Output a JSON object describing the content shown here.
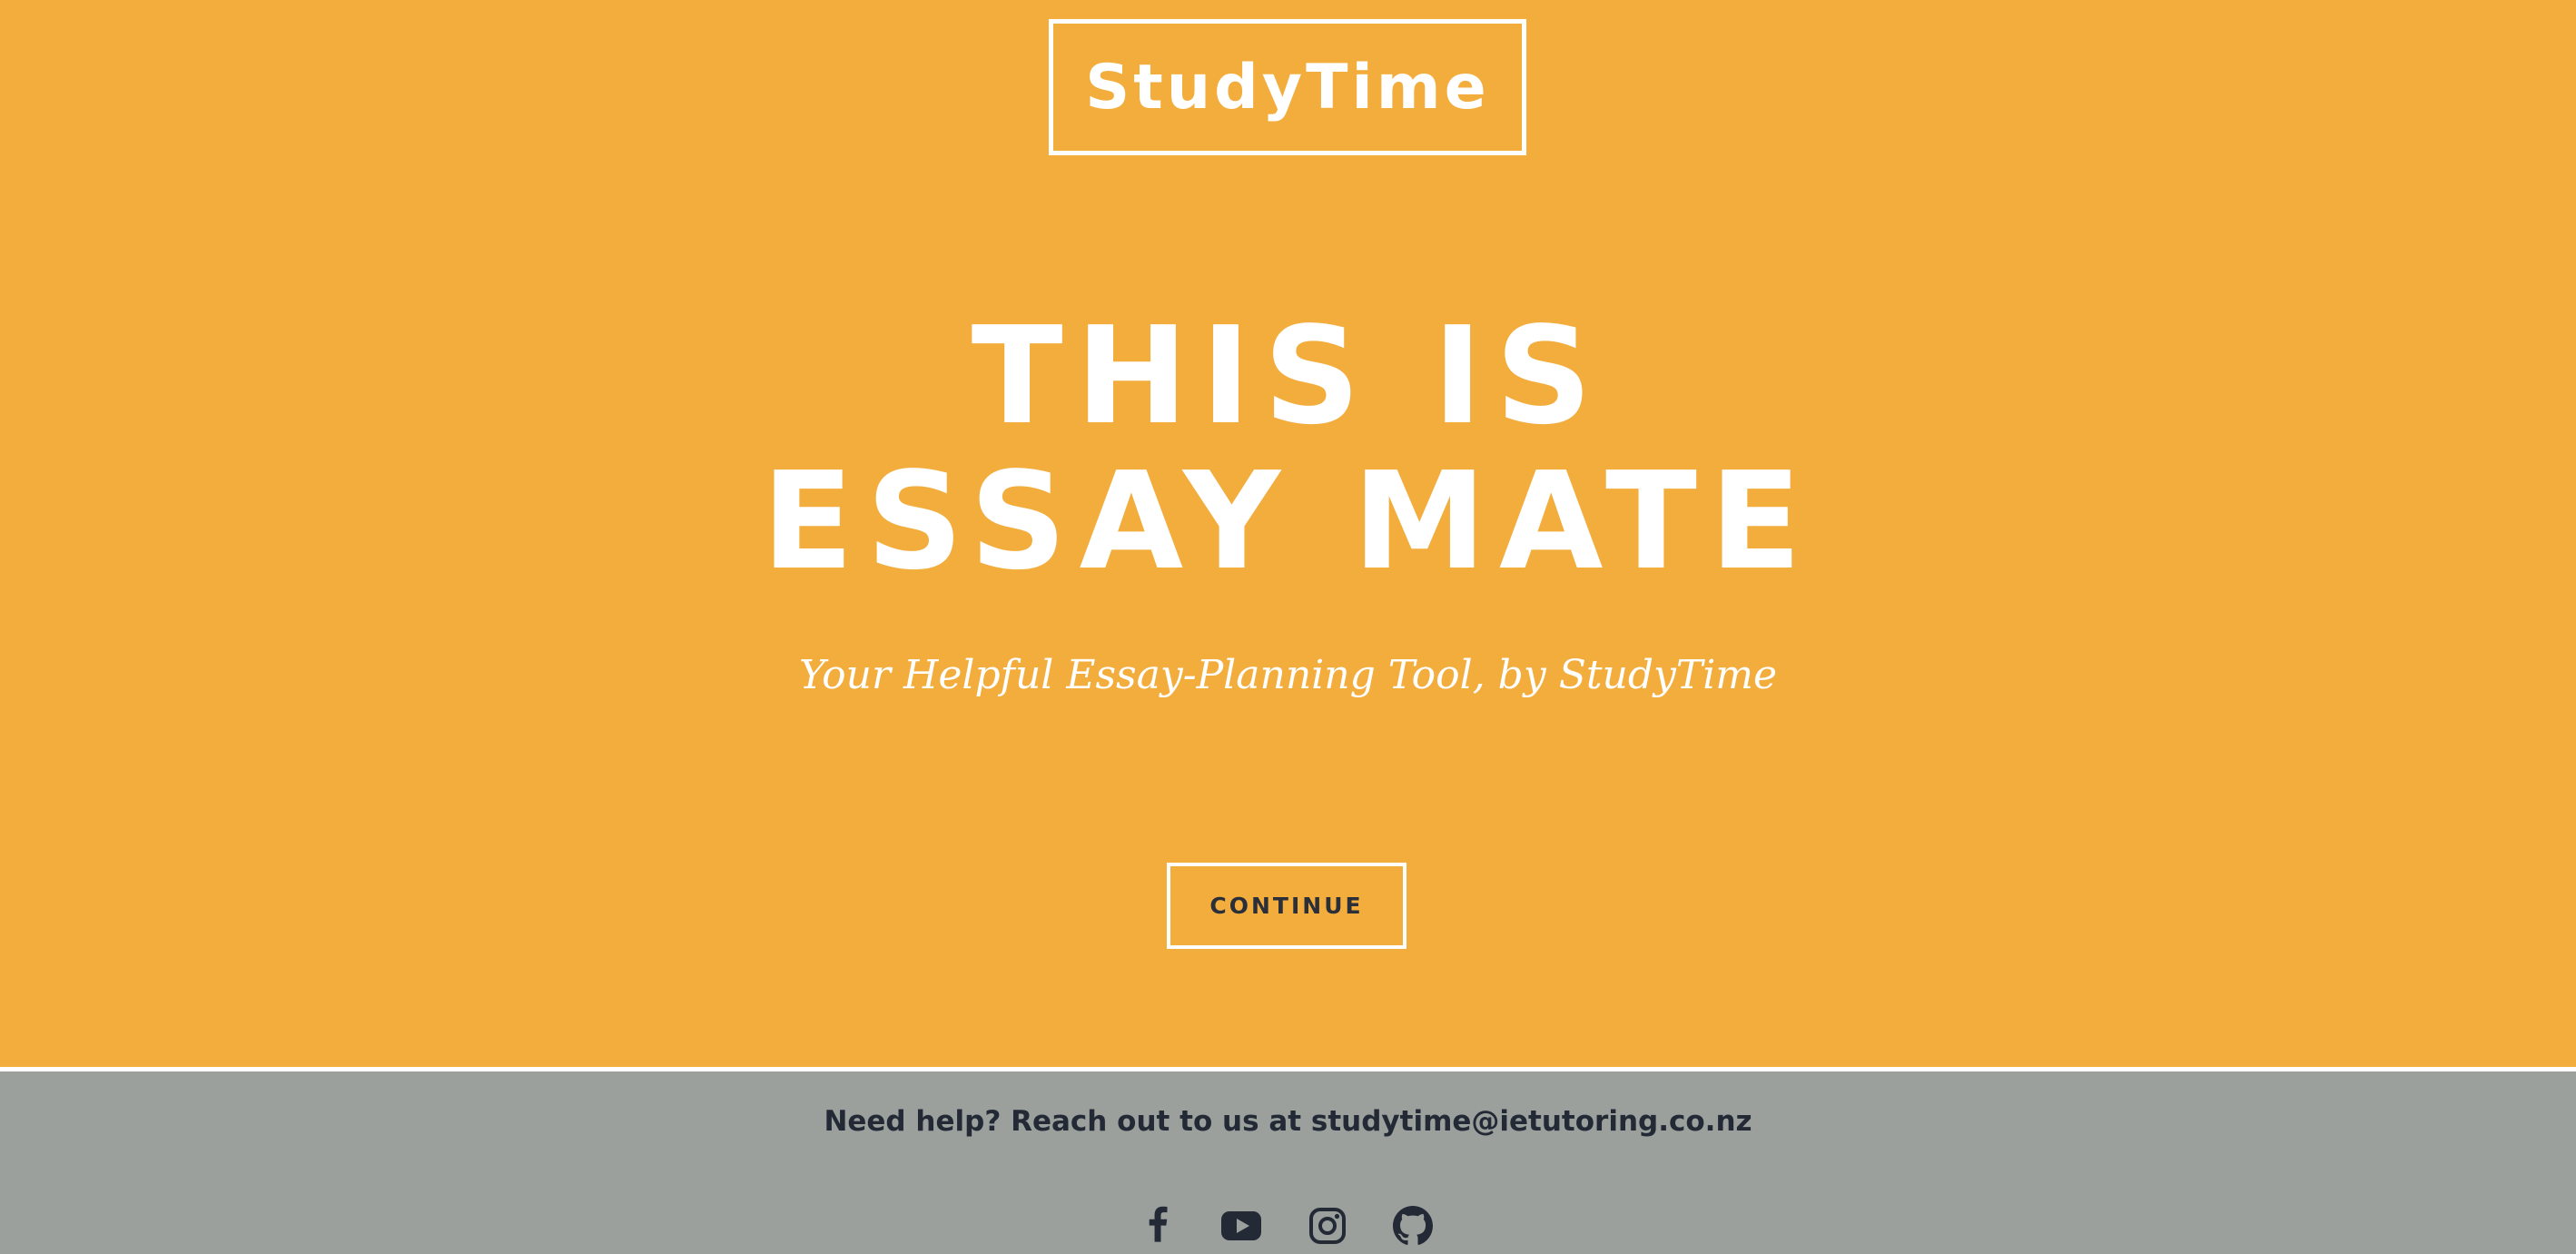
{
  "brand": {
    "logo_text": "StudyTime"
  },
  "hero": {
    "headline_line1": "THIS IS",
    "headline_line2": "ESSAY MATE",
    "tagline": "Your Helpful Essay-Planning Tool, by StudyTime",
    "continue_label": "CONTINUE"
  },
  "footer": {
    "help_text": "Need help? Reach out to us at studytime@ietutoring.co.nz",
    "social_icons": [
      "facebook-icon",
      "youtube-icon",
      "instagram-icon",
      "github-icon"
    ]
  },
  "colors": {
    "hero_background": "#f2ad3d",
    "footer_background": "#9ba09d",
    "text_light": "#ffffff",
    "text_dark": "#232a36"
  }
}
